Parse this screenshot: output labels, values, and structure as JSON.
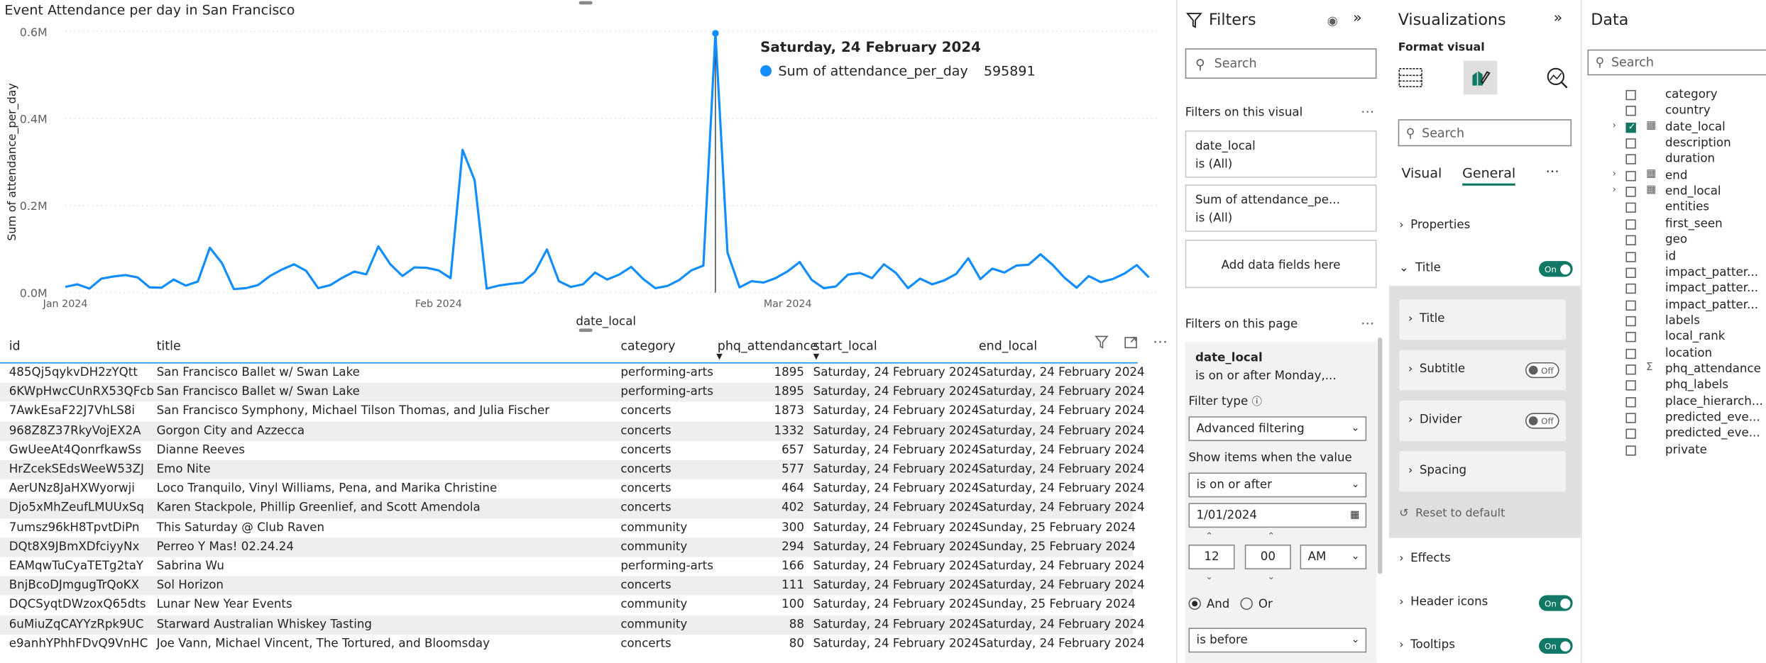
{
  "chart": {
    "title": "Event Attendance per day in San Francisco",
    "tooltip_title": "Saturday, 24 February 2024",
    "tooltip_series": "Sum of attendance_per_day",
    "tooltip_value": "595891"
  },
  "chart_data": {
    "type": "line",
    "xlabel": "date_local",
    "ylabel": "Sum of attendance_per_day",
    "x_ticks": [
      "Jan 2024",
      "Feb 2024",
      "Mar 2024"
    ],
    "y_ticks": [
      "0.0M",
      "0.2M",
      "0.4M",
      "0.6M"
    ],
    "ylim": [
      0,
      600000
    ],
    "x_start": "2024-01-01",
    "line_color": "#118DFF",
    "series": [
      {
        "values": [
          13000,
          19000,
          9000,
          32000,
          37000,
          40000,
          35000,
          12000,
          11000,
          30000,
          16000,
          25000,
          103000,
          68000,
          8000,
          10000,
          17000,
          38000,
          53000,
          65000,
          50000,
          10000,
          17000,
          34000,
          48000,
          42000,
          106000,
          65000,
          38000,
          58000,
          57000,
          51000,
          33000,
          328000,
          258000,
          9000,
          16000,
          20000,
          23000,
          47000,
          99000,
          26000,
          13000,
          19000,
          46000,
          30000,
          41000,
          59000,
          31000,
          10000,
          15000,
          29000,
          51000,
          62000,
          595891,
          92000,
          12000,
          26000,
          23000,
          33000,
          49000,
          70000,
          29000,
          10000,
          14000,
          41000,
          45000,
          33000,
          65000,
          45000,
          10000,
          32000,
          19000,
          28000,
          43000,
          79000,
          31000,
          55000,
          46000,
          62000,
          64000,
          88000,
          64000,
          34000,
          11000,
          38000,
          24000,
          31000,
          44000,
          63000,
          35000
        ]
      }
    ]
  },
  "table": {
    "columns": [
      "id",
      "title",
      "category",
      "phq_attendance",
      "start_local",
      "end_local"
    ],
    "rows": [
      [
        "485Qj5qykvDH2zYQtt",
        "San Francisco Ballet w/ Swan Lake",
        "performing-arts",
        "1895",
        "Saturday, 24 February 2024",
        "Saturday, 24 February 2024"
      ],
      [
        "6KWpHwcCUnRX53QFcb",
        "San Francisco Ballet w/ Swan Lake",
        "performing-arts",
        "1895",
        "Saturday, 24 February 2024",
        "Saturday, 24 February 2024"
      ],
      [
        "7AwkEsaF22J7VhLS8i",
        "San Francisco Symphony, Michael Tilson Thomas, and Julia Fischer",
        "concerts",
        "1873",
        "Saturday, 24 February 2024",
        "Saturday, 24 February 2024"
      ],
      [
        "968Z8Z37RkyVojEX2A",
        "Gorgon City and Azzecca",
        "concerts",
        "1332",
        "Saturday, 24 February 2024",
        "Saturday, 24 February 2024"
      ],
      [
        "GwUeeAt4QonrfkawSs",
        "Dianne Reeves",
        "concerts",
        "657",
        "Saturday, 24 February 2024",
        "Saturday, 24 February 2024"
      ],
      [
        "HrZcekSEdsWeeW53ZJ",
        "Emo Nite",
        "concerts",
        "577",
        "Saturday, 24 February 2024",
        "Saturday, 24 February 2024"
      ],
      [
        "AerUNz8JaHXWyorwji",
        "Loco Tranquilo, Vinyl Williams, Pena, and Marika Christine",
        "concerts",
        "464",
        "Saturday, 24 February 2024",
        "Saturday, 24 February 2024"
      ],
      [
        "Djo5xMhZeufLMUUxSq",
        "Karen Stackpole, Phillip Greenlief, and Scott Amendola",
        "concerts",
        "402",
        "Saturday, 24 February 2024",
        "Saturday, 24 February 2024"
      ],
      [
        "7umsz96kH8TpvtDiPn",
        "This Saturday @ Club Raven",
        "community",
        "300",
        "Saturday, 24 February 2024",
        "Sunday, 25 February 2024"
      ],
      [
        "DQt8X9JBmXDfciyyNx",
        "Perreo Y Mas! 02.24.24",
        "community",
        "294",
        "Saturday, 24 February 2024",
        "Sunday, 25 February 2024"
      ],
      [
        "EAMqwTuCyaTETg2taY",
        "Sabrina Wu",
        "performing-arts",
        "166",
        "Saturday, 24 February 2024",
        "Saturday, 24 February 2024"
      ],
      [
        "BnjBcoDJmgugTrQoKX",
        "Sol Horizon",
        "concerts",
        "111",
        "Saturday, 24 February 2024",
        "Saturday, 24 February 2024"
      ],
      [
        "DQCSyqtDWzoxQ65dts",
        "Lunar New Year Events",
        "community",
        "100",
        "Saturday, 24 February 2024",
        "Sunday, 25 February 2024"
      ],
      [
        "6uMiuZqCAYYzRpk9UC",
        "Starward Australian Whiskey Tasting",
        "community",
        "88",
        "Saturday, 24 February 2024",
        "Saturday, 24 February 2024"
      ],
      [
        "e9anhYPhhFDvQ9VnHC",
        "Joe Vann, Michael Vincent, The Tortured, and Bloomsday",
        "concerts",
        "80",
        "Saturday, 24 February 2024",
        "Saturday, 24 February 2024"
      ]
    ]
  },
  "filters": {
    "header": "Filters",
    "search_placeholder": "Search",
    "on_visual_label": "Filters on this visual",
    "visual_filters": [
      {
        "field": "date_local",
        "state": "is (All)"
      },
      {
        "field": "Sum of attendance_pe...",
        "state": "is (All)"
      }
    ],
    "add_fields": "Add data fields here",
    "on_page_label": "Filters on this page",
    "page_filter": {
      "field": "date_local",
      "summary": "is on or after Monday,...",
      "filter_type_label": "Filter type",
      "filter_type": "Advanced filtering",
      "show_items_label": "Show items when the value",
      "condition1": "is on or after",
      "date1": "1/01/2024",
      "hour": "12",
      "minute": "00",
      "ampm": "AM",
      "and_label": "And",
      "or_label": "Or",
      "condition2": "is before"
    }
  },
  "visualizations": {
    "header": "Visualizations",
    "format_visual": "Format visual",
    "search_placeholder": "Search",
    "tab_visual": "Visual",
    "tab_general": "General",
    "properties": "Properties",
    "title_section": "Title",
    "title_toggle": "On",
    "title_sub": "Title",
    "subtitle": "Subtitle",
    "subtitle_toggle": "Off",
    "divider": "Divider",
    "divider_toggle": "Off",
    "spacing": "Spacing",
    "reset": "Reset to default",
    "effects": "Effects",
    "header_icons": "Header icons",
    "header_icons_toggle": "On",
    "tooltips": "Tooltips",
    "tooltips_toggle": "On"
  },
  "data_pane": {
    "header": "Data",
    "search_placeholder": "Search",
    "fields": [
      {
        "name": "category",
        "type": "text",
        "checked": false,
        "expandable": false
      },
      {
        "name": "country",
        "type": "text",
        "checked": false,
        "expandable": false
      },
      {
        "name": "date_local",
        "type": "date-table",
        "checked": true,
        "expandable": true
      },
      {
        "name": "description",
        "type": "text",
        "checked": false,
        "expandable": false
      },
      {
        "name": "duration",
        "type": "text",
        "checked": false,
        "expandable": false
      },
      {
        "name": "end",
        "type": "date-table",
        "checked": false,
        "expandable": true
      },
      {
        "name": "end_local",
        "type": "date-table",
        "checked": false,
        "expandable": true
      },
      {
        "name": "entities",
        "type": "text",
        "checked": false,
        "expandable": false
      },
      {
        "name": "first_seen",
        "type": "text",
        "checked": false,
        "expandable": false
      },
      {
        "name": "geo",
        "type": "text",
        "checked": false,
        "expandable": false
      },
      {
        "name": "id",
        "type": "text",
        "checked": false,
        "expandable": false
      },
      {
        "name": "impact_patter...",
        "type": "text",
        "checked": false,
        "expandable": false
      },
      {
        "name": "impact_patter...",
        "type": "text",
        "checked": false,
        "expandable": false
      },
      {
        "name": "impact_patter...",
        "type": "text",
        "checked": false,
        "expandable": false
      },
      {
        "name": "labels",
        "type": "text",
        "checked": false,
        "expandable": false
      },
      {
        "name": "local_rank",
        "type": "text",
        "checked": false,
        "expandable": false
      },
      {
        "name": "location",
        "type": "text",
        "checked": false,
        "expandable": false
      },
      {
        "name": "phq_attendance",
        "type": "sum",
        "checked": false,
        "expandable": false
      },
      {
        "name": "phq_labels",
        "type": "text",
        "checked": false,
        "expandable": false
      },
      {
        "name": "place_hierarch...",
        "type": "text",
        "checked": false,
        "expandable": false
      },
      {
        "name": "predicted_eve...",
        "type": "text",
        "checked": false,
        "expandable": false
      },
      {
        "name": "predicted_eve...",
        "type": "text",
        "checked": false,
        "expandable": false
      },
      {
        "name": "private",
        "type": "text",
        "checked": false,
        "expandable": false
      }
    ]
  }
}
